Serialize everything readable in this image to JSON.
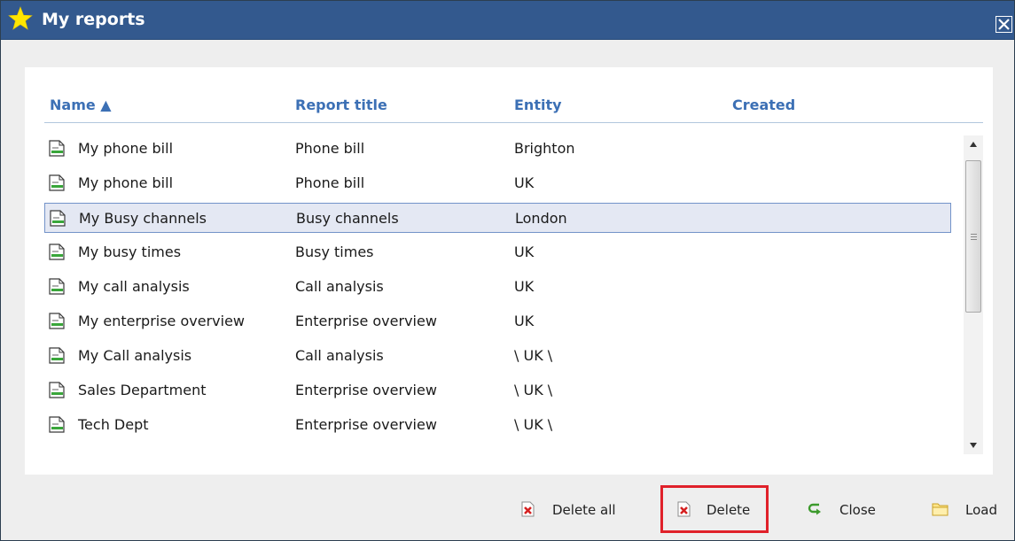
{
  "window": {
    "title": "My reports"
  },
  "columns": {
    "name": "Name ▲",
    "report_title": "Report title",
    "entity": "Entity",
    "created": "Created"
  },
  "rows": [
    {
      "name": "My phone bill",
      "report_title": "Phone bill",
      "entity": "Brighton",
      "created": ""
    },
    {
      "name": "My phone bill",
      "report_title": "Phone bill",
      "entity": "UK",
      "created": ""
    },
    {
      "name": "My Busy channels",
      "report_title": "Busy channels",
      "entity": "London",
      "created": ""
    },
    {
      "name": "My busy times",
      "report_title": "Busy times",
      "entity": "UK",
      "created": ""
    },
    {
      "name": "My call analysis",
      "report_title": "Call analysis",
      "entity": "UK",
      "created": ""
    },
    {
      "name": "My enterprise overview",
      "report_title": "Enterprise overview",
      "entity": "UK",
      "created": ""
    },
    {
      "name": "My Call analysis",
      "report_title": "Call analysis",
      "entity": "\\ UK \\",
      "created": ""
    },
    {
      "name": "Sales Department",
      "report_title": "Enterprise overview",
      "entity": "\\ UK \\",
      "created": ""
    },
    {
      "name": "Tech Dept",
      "report_title": "Enterprise overview",
      "entity": "\\ UK \\",
      "created": ""
    }
  ],
  "selected_row": 2,
  "buttons": {
    "delete_all": "Delete all",
    "delete": "Delete",
    "close": "Close",
    "load": "Load"
  },
  "colors": {
    "titlebar": "#33598e",
    "header_text": "#3c70b5",
    "selection": "#e4e8f3",
    "highlight": "#e0212a"
  },
  "icons": {
    "title": "star-icon",
    "close": "close-box-icon",
    "row": "report-document-icon",
    "delete_all": "delete-x-icon",
    "delete": "delete-x-icon",
    "close_button": "green-arrow-icon",
    "load": "folder-icon"
  }
}
